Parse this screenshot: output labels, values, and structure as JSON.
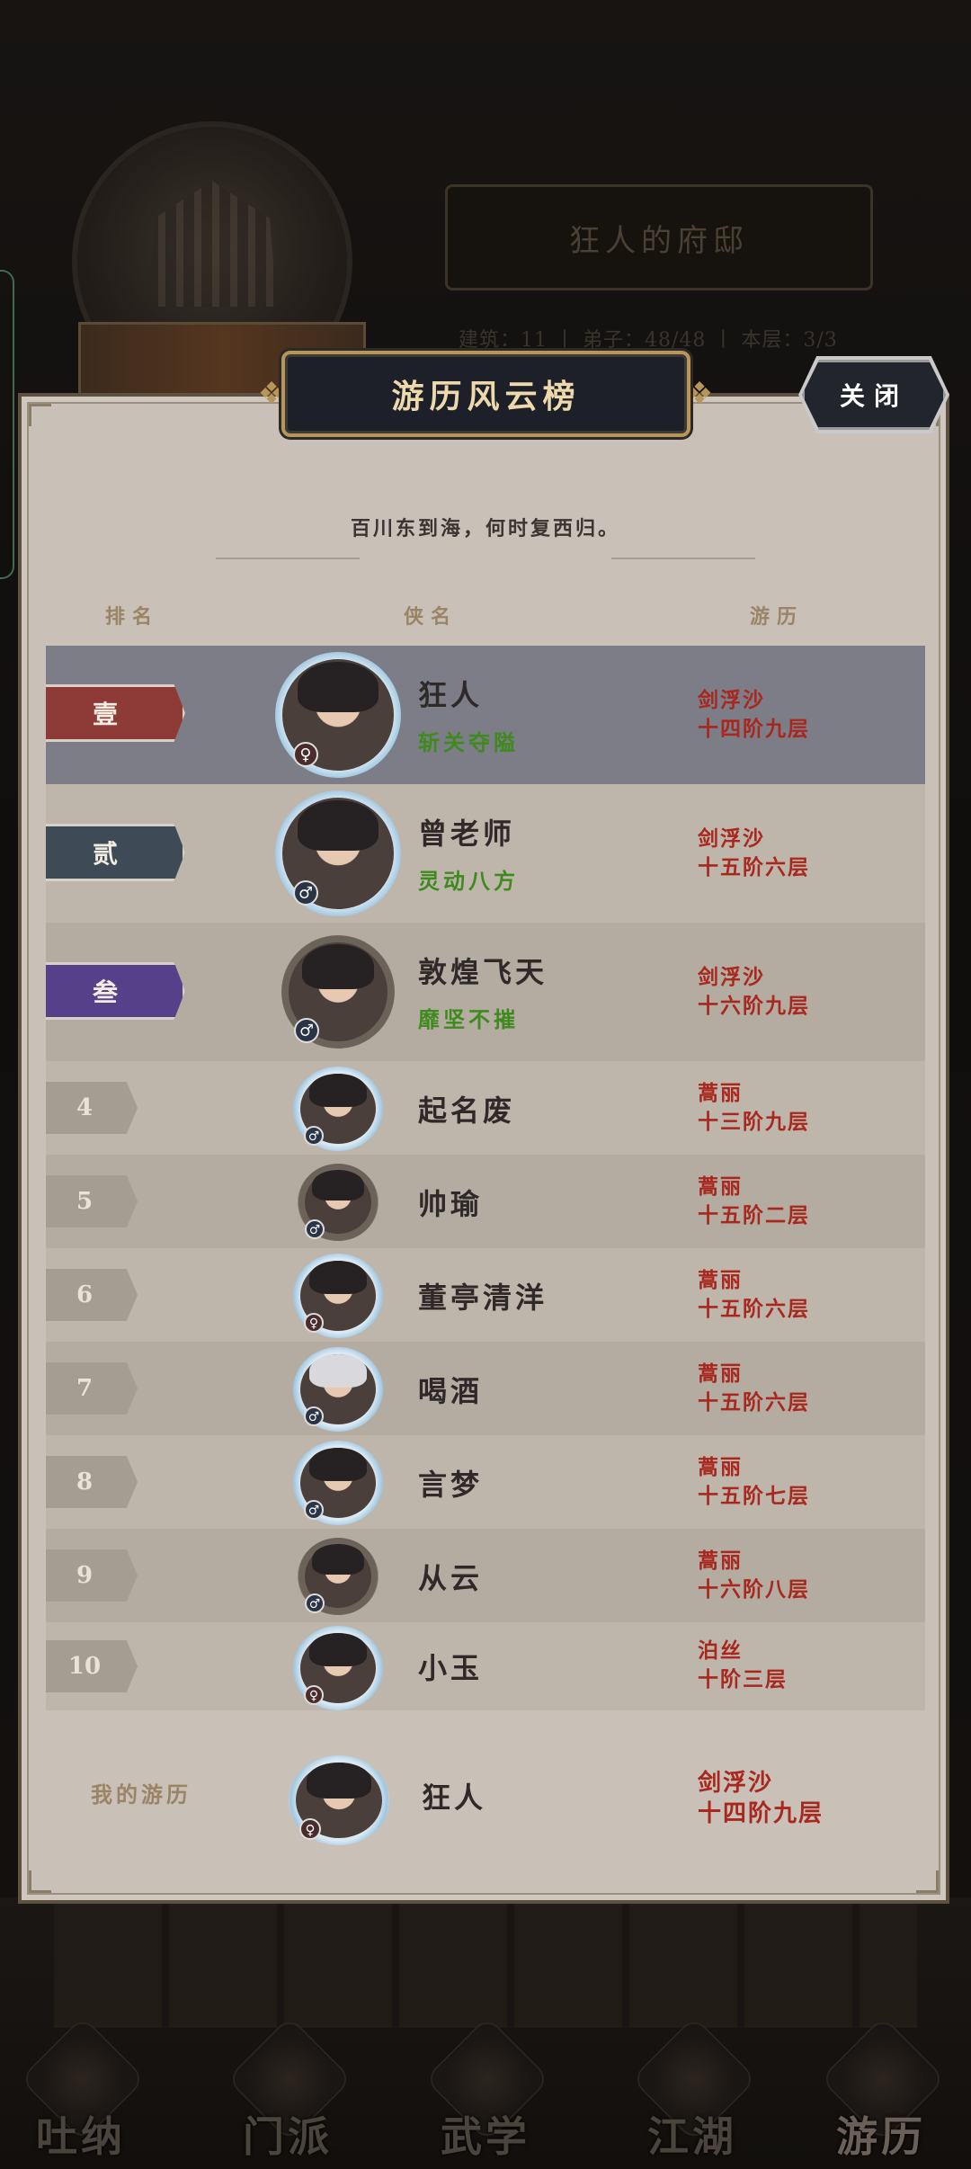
{
  "background": {
    "building_title": "狂人的府邸",
    "stats_text": "建筑：11 丨 弟子：48/48 丨 本层：3/3",
    "nav": [
      {
        "label": "吐纳"
      },
      {
        "label": "门派"
      },
      {
        "label": "武学"
      },
      {
        "label": "江湖"
      },
      {
        "label": "游历"
      }
    ]
  },
  "panel": {
    "title": "游历风云榜",
    "close_label": "关闭",
    "motto": "百川东到海，何时复西归。",
    "headers": {
      "rank": "排名",
      "name": "侠名",
      "progress": "游历"
    }
  },
  "leaderboard": [
    {
      "rank": "壹",
      "name": "狂人",
      "title": "斩关夺隘",
      "gender": "♀",
      "frame": "frost",
      "realm": "剑浮沙",
      "level": "十四阶九层",
      "ribbon_color": "#8e3a36"
    },
    {
      "rank": "贰",
      "name": "曾老师",
      "title": "灵动八方",
      "gender": "♂",
      "frame": "frost",
      "realm": "剑浮沙",
      "level": "十五阶六层",
      "ribbon_color": "#3e4a55"
    },
    {
      "rank": "叁",
      "name": "敦煌飞天",
      "title": "靡坚不摧",
      "gender": "♂",
      "frame": "bronze",
      "realm": "剑浮沙",
      "level": "十六阶九层",
      "ribbon_color": "#55418a"
    },
    {
      "rank": "4",
      "name": "起名废",
      "gender": "♂",
      "frame": "frost",
      "realm": "蒿丽",
      "level": "十三阶九层"
    },
    {
      "rank": "5",
      "name": "帅瑜",
      "gender": "♂",
      "frame": "bronze",
      "realm": "蒿丽",
      "level": "十五阶二层"
    },
    {
      "rank": "6",
      "name": "董亭清洋",
      "gender": "♀",
      "frame": "frost",
      "realm": "蒿丽",
      "level": "十五阶六层"
    },
    {
      "rank": "7",
      "name": "喝酒",
      "gender": "♂",
      "frame": "frost",
      "realm": "蒿丽",
      "level": "十五阶六层"
    },
    {
      "rank": "8",
      "name": "言梦",
      "gender": "♂",
      "frame": "frost",
      "realm": "蒿丽",
      "level": "十五阶七层"
    },
    {
      "rank": "9",
      "name": "从云",
      "gender": "♂",
      "frame": "bronze",
      "realm": "蒿丽",
      "level": "十六阶八层"
    },
    {
      "rank": "10",
      "name": "小玉",
      "gender": "♀",
      "frame": "frost",
      "realm": "泊丝",
      "level": "十阶三层"
    }
  ],
  "me": {
    "label": "我的游历",
    "name": "狂人",
    "gender": "♀",
    "realm": "剑浮沙",
    "level": "十四阶九层"
  },
  "colors": {
    "panel_bg": "#c9c1b7",
    "highlight_row": "#7c7d86",
    "progress_red": "#a8271e",
    "title_green": "#3f8a1e",
    "gold": "#b8965a"
  }
}
